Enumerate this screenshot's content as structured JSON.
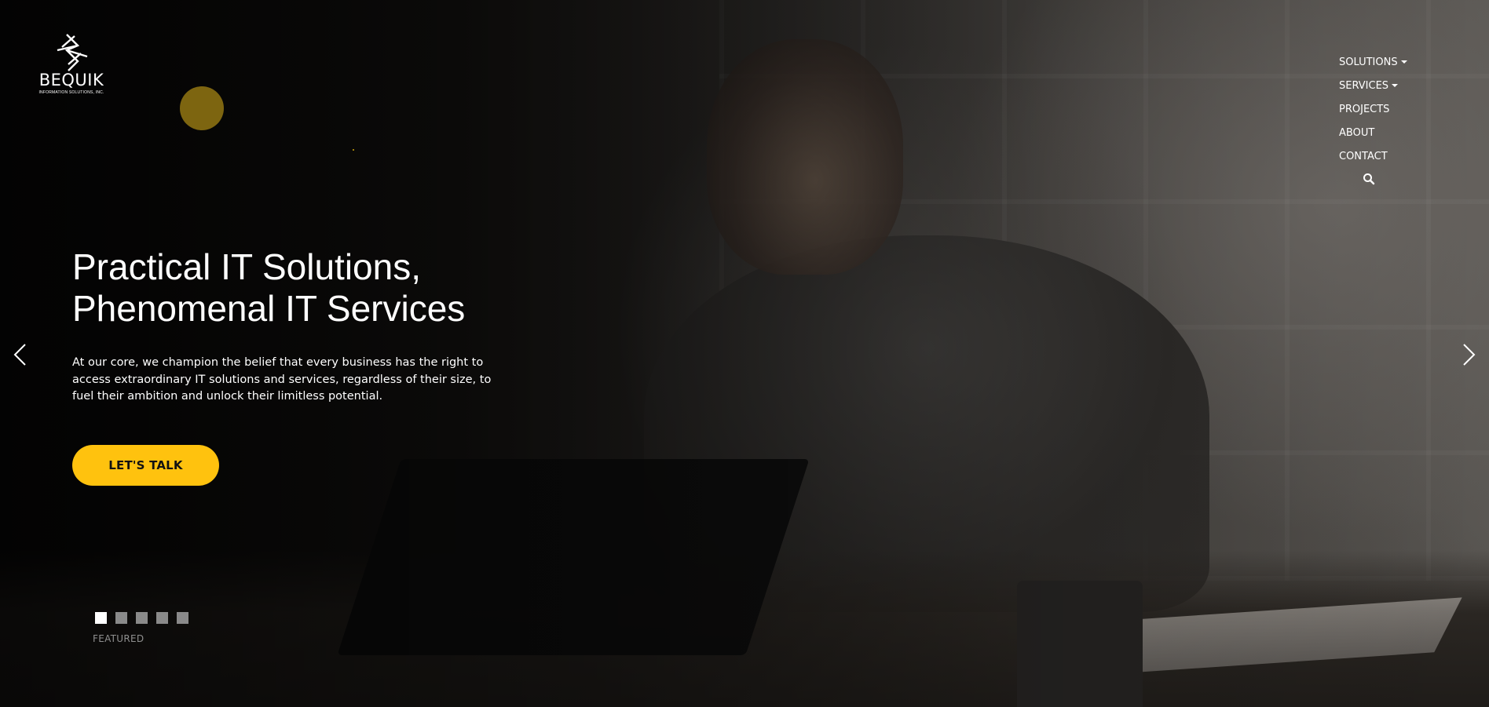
{
  "logo": {
    "name": "BEQUIK",
    "tagline": "INFORMATION SOLUTIONS, INC."
  },
  "nav": {
    "items": [
      {
        "label": "SOLUTIONS",
        "has_dropdown": true
      },
      {
        "label": "SERVICES",
        "has_dropdown": true
      },
      {
        "label": "PROJECTS",
        "has_dropdown": false
      },
      {
        "label": "ABOUT",
        "has_dropdown": false
      },
      {
        "label": "CONTACT",
        "has_dropdown": false
      }
    ],
    "search_icon": "search-icon"
  },
  "hero": {
    "title_line1": "Practical IT Solutions,",
    "title_line2": "Phenomenal IT Services",
    "subtitle": "At our core, we champion the belief that every business has the right to access extraordinary IT solutions and services, regardless of their size, to fuel their ambition and unlock their limitless potential.",
    "cta_label": "LET'S TALK"
  },
  "slider": {
    "prev_icon": "chevron-left-icon",
    "next_icon": "chevron-right-icon",
    "slide_count": 5,
    "active_index": 0,
    "caption": "FEATURED"
  },
  "colors": {
    "accent": "#ffc20e",
    "text": "#ffffff",
    "caption": "#8f8f8f"
  }
}
